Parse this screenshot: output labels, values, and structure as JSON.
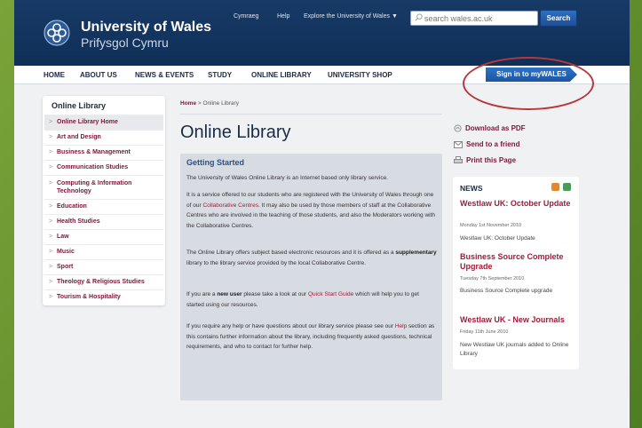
{
  "brand": {
    "name_en": "University of Wales",
    "name_cy": "Prifysgol Cymru"
  },
  "toplinks": {
    "cymraeg": "Cymraeg",
    "help": "Help",
    "explore": "Explore the University of Wales ▼"
  },
  "search": {
    "placeholder": "search wales.ac.uk",
    "button": "Search"
  },
  "nav": {
    "items": [
      "HOME",
      "ABOUT US",
      "NEWS & EVENTS",
      "STUDY",
      "ONLINE LIBRARY",
      "UNIVERSITY SHOP"
    ],
    "signin": "Sign in to myWALES"
  },
  "sidebar": {
    "title": "Online Library",
    "items": [
      "Online Library Home",
      "Art and Design",
      "Business & Management",
      "Communication Studies",
      "Computing & Information Technology",
      "Education",
      "Health Studies",
      "Law",
      "Music",
      "Sport",
      "Theology & Religious Studies",
      "Tourism & Hospitality"
    ]
  },
  "breadcrumb": {
    "home": "Home",
    "sep": " > ",
    "current": "Online Library"
  },
  "main": {
    "title": "Online Library",
    "section_heading": "Getting Started",
    "p1": "The University of Wales Online Library is an Internet based only library service.",
    "p2_a": "It is a service offered to our students who are registered with the University of Wales through one of our ",
    "p2_link": "Collaborative Centres",
    "p2_b": ". It may also be used by those members of staff at the Collaborative Centres who are involved in the teaching of those students, and also the Moderators working with the Collaborative Centres.",
    "p3_a": "The Online Library offers subject based electronic resources and it is offered as a ",
    "p3_bold": "supplementary",
    "p3_b": " library to the library service provided by the local Collaborative Centre.",
    "p4_a": "If you are a ",
    "p4_bold": "new user",
    "p4_b": " please take a look at our ",
    "p4_link": "Quick Start Guide",
    "p4_c": " which will help you to get started using our resources.",
    "p5_a": "If you require any help or have questions about our library service please see our ",
    "p5_link": "Help",
    "p5_b": " section as this contains further information about the library, including frequently asked questions, technical requirements, and who to contact for further help."
  },
  "actions": {
    "pdf": "Download as PDF",
    "friend": "Send to a friend",
    "print": "Print this Page"
  },
  "news": {
    "title": "NEWS",
    "items": [
      {
        "headline": "Westlaw UK: October Update",
        "date": "Monday 1st November 2010",
        "summary": "Westlaw UK: October Update"
      },
      {
        "headline": "Business Source Complete Upgrade",
        "date": "Tuesday 7th September 2010",
        "summary": "Business Source Complete upgrade"
      },
      {
        "headline": "Westlaw UK - New Journals",
        "date": "Friday 11th June 2010",
        "summary": "New Westlaw UK journals added to Online Library"
      }
    ]
  },
  "colors": {
    "header_blue": "#173a66",
    "link_maroon": "#7a1838",
    "annotation_red": "#b8373b",
    "frame_green": "#5c8a2c"
  }
}
